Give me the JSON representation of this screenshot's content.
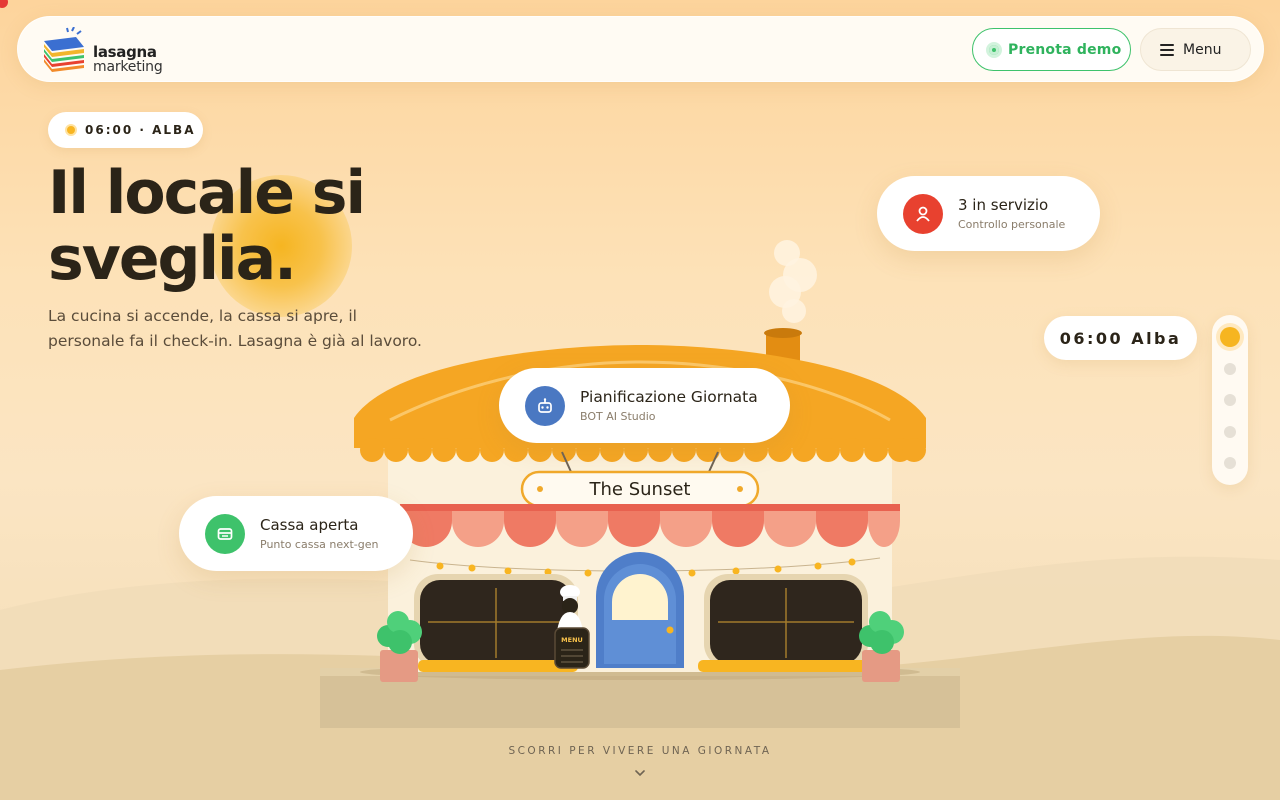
{
  "header": {
    "logo_line1": "lasagna",
    "logo_line2": "marketing",
    "demo_label": "Prenota demo",
    "menu_label": "Menu"
  },
  "hero": {
    "time_pill": "06:00 · ALBA",
    "title": "Il locale si sveglia.",
    "subtitle": "La cucina si accende, la cassa si apre, il personale fa il check-in. Lasagna è già al lavoro."
  },
  "cards": {
    "staff": {
      "title": "3 in servizio",
      "subtitle": "Controllo personale"
    },
    "plan": {
      "title": "Pianificazione Giornata",
      "subtitle": "BOT AI Studio"
    },
    "cash": {
      "title": "Cassa aperta",
      "subtitle": "Punto cassa next-gen"
    }
  },
  "clock": "06:00 Alba",
  "shop_sign": "The Sunset",
  "menu_board": "MENU",
  "scroll_hint": "SCORRI PER VIVERE UNA GIORNATA",
  "timeline": {
    "steps": 5,
    "active_index": 0
  },
  "colors": {
    "accent_green": "#3ec26b",
    "sun_yellow": "#f6b521",
    "staff_red": "#e8412f",
    "plan_blue": "#4a78c2",
    "cash_green": "#3ec26b"
  },
  "icons": {
    "staff": "person-icon",
    "plan": "robot-icon",
    "cash": "cash-register-icon",
    "menu": "hamburger-icon",
    "scroll": "chevron-down-icon"
  }
}
